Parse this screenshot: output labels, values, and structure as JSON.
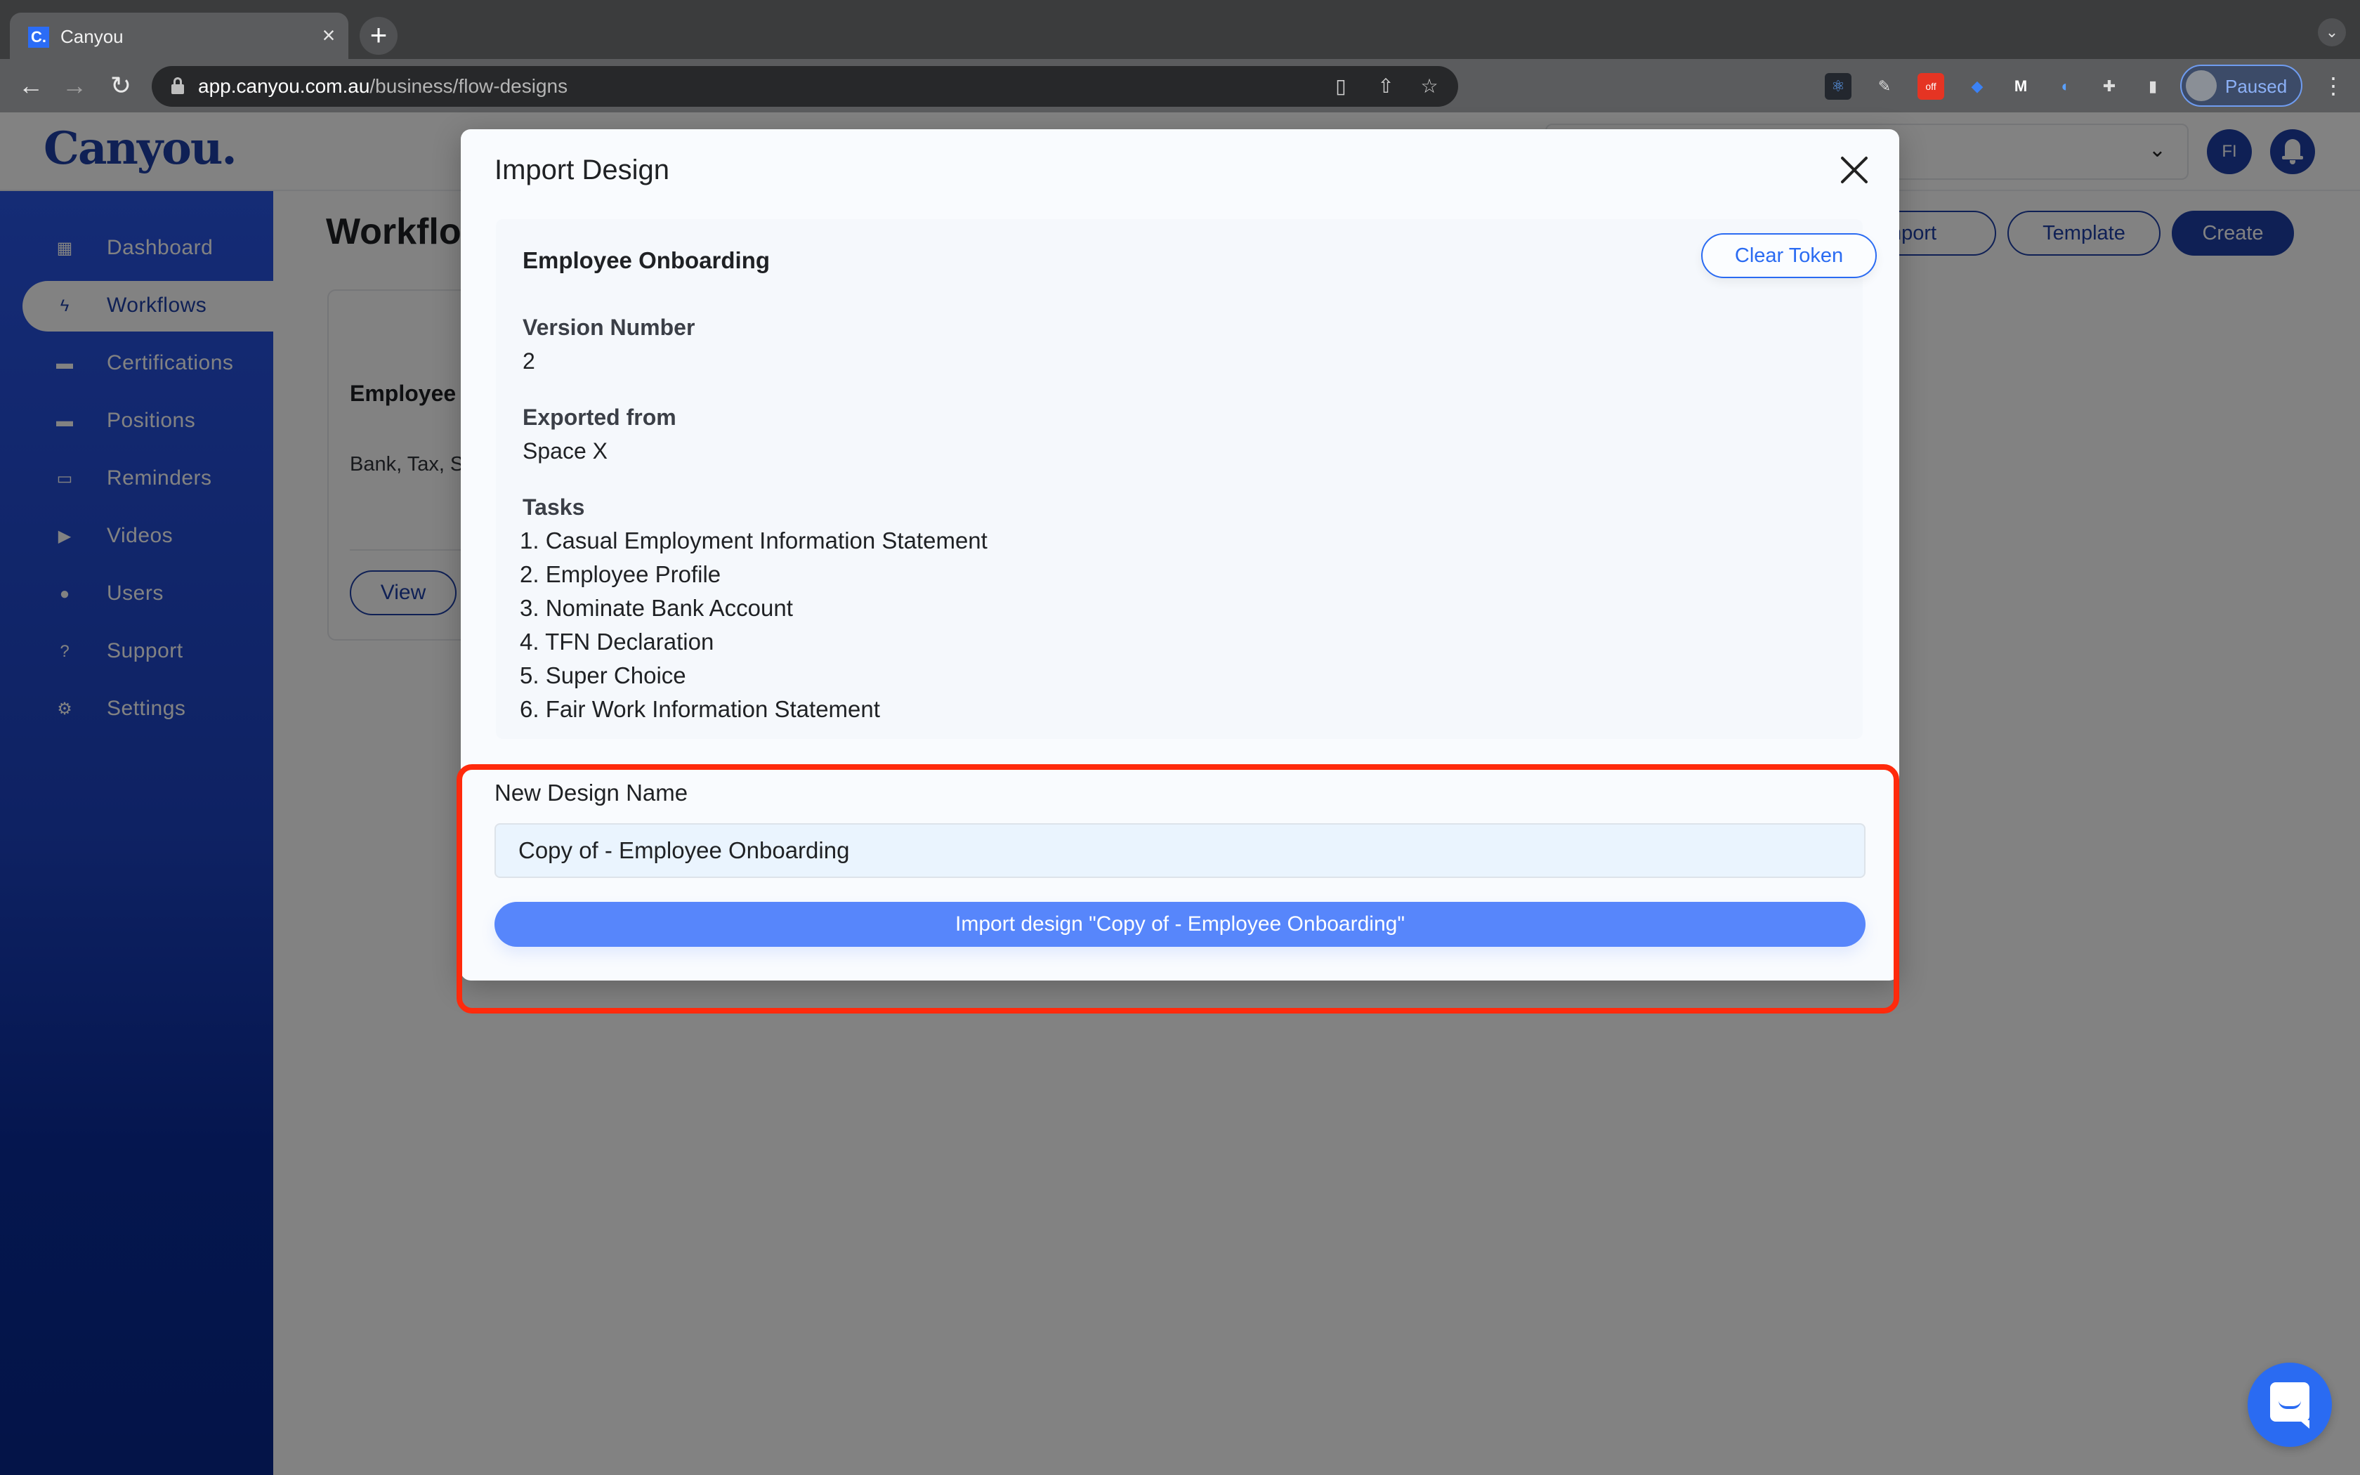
{
  "browser": {
    "tab_title": "Canyou",
    "tab_favicon": "C.",
    "tab_close": "×",
    "new_tab": "+",
    "url_host": "app.canyou.com.au",
    "url_path": "/business/flow-designs",
    "profile_label": "Paused",
    "extensions": [
      "react-devtools-icon",
      "color-picker-icon",
      "cors-off-icon",
      "tag-icon",
      "m-icon",
      "password-manager-icon",
      "puzzle-extensions-icon",
      "sidepanel-icon"
    ]
  },
  "app": {
    "logo": "Canyou.",
    "user_initials": "FI",
    "brand_color": "#1e3fa8",
    "sidebar": {
      "items": [
        {
          "label": "Dashboard",
          "icon": "dashboard-icon",
          "active": false
        },
        {
          "label": "Workflows",
          "icon": "lightning-icon",
          "active": true
        },
        {
          "label": "Certifications",
          "icon": "briefcase-icon",
          "active": false
        },
        {
          "label": "Positions",
          "icon": "briefcase-icon",
          "active": false
        },
        {
          "label": "Reminders",
          "icon": "calendar-icon",
          "active": false
        },
        {
          "label": "Videos",
          "icon": "video-icon",
          "active": false
        },
        {
          "label": "Users",
          "icon": "user-icon",
          "active": false
        },
        {
          "label": "Support",
          "icon": "chat-help-icon",
          "active": false
        },
        {
          "label": "Settings",
          "icon": "gear-icon",
          "active": false
        }
      ]
    },
    "page": {
      "title": "Workflows",
      "buttons": {
        "import": "Import",
        "template": "Template",
        "create": "Create"
      },
      "card": {
        "title": "Employee Onboarding",
        "description": "Bank, Tax, Super and Fair Work information",
        "view_label": "View"
      }
    }
  },
  "modal": {
    "title": "Import Design",
    "design_name": "Employee Onboarding",
    "clear_token_label": "Clear Token",
    "version_label": "Version Number",
    "version_value": "2",
    "exported_label": "Exported from",
    "exported_value": "Space X",
    "tasks_label": "Tasks",
    "tasks": [
      "1. Casual Employment Information Statement",
      "2. Employee Profile",
      "3. Nominate Bank Account",
      "4. TFN Declaration",
      "5. Super Choice",
      "6. Fair Work Information Statement"
    ],
    "new_name_label": "New Design Name",
    "new_name_value": "Copy of - Employee Onboarding",
    "import_button_label": "Import design \"Copy of - Employee Onboarding\"",
    "highlight_color": "#ff2a0c"
  }
}
